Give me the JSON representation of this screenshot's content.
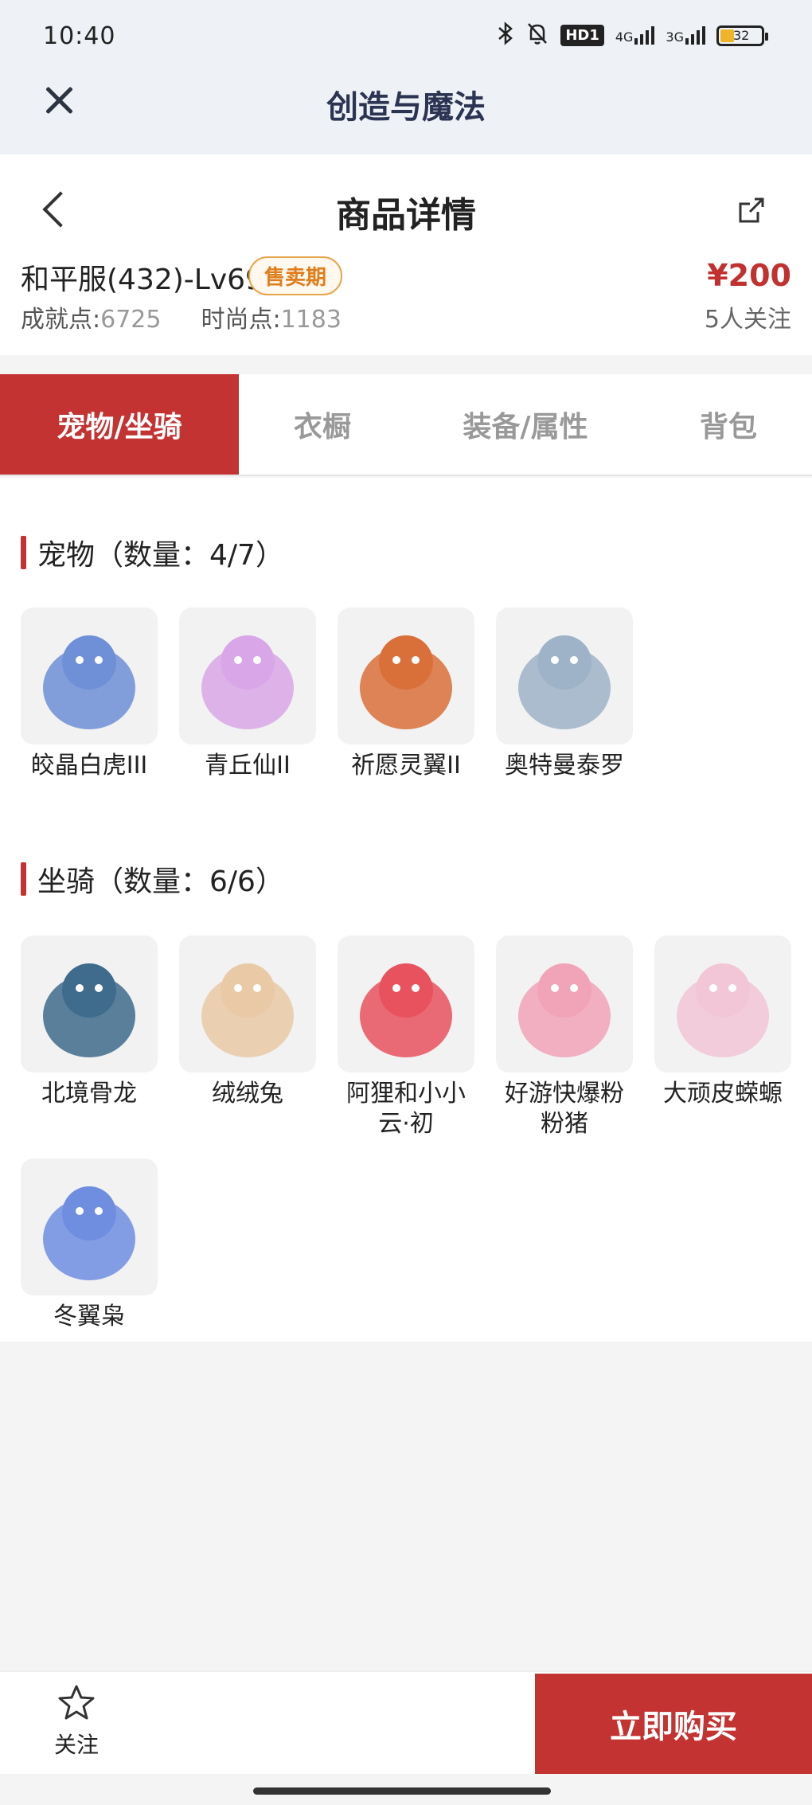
{
  "status_bar": {
    "time": "10:40",
    "hd_label": "HD1",
    "net1": "4G",
    "net2": "3G",
    "battery": "32",
    "battery_fraction": 0.32
  },
  "app": {
    "title": "创造与魔法"
  },
  "product": {
    "page_title": "商品详情",
    "name": "和平服(432)-Lv69",
    "badge": "售卖期",
    "price": "¥200",
    "achievement_label": "成就点:",
    "achievement_value": "6725",
    "fashion_label": "时尚点:",
    "fashion_value": "1183",
    "followers": "5人关注"
  },
  "tabs": [
    {
      "label": "宠物/坐骑",
      "active": true
    },
    {
      "label": "衣橱",
      "active": false
    },
    {
      "label": "装备/属性",
      "active": false
    },
    {
      "label": "背包",
      "active": false
    }
  ],
  "pets": {
    "title": "宠物（数量：4/7）",
    "items": [
      {
        "name": "皎晶白虎III",
        "color": "#6f8fd6",
        "icon": "tiger-icon"
      },
      {
        "name": "青丘仙II",
        "color": "#d9a7e8",
        "icon": "fox-spirit-icon"
      },
      {
        "name": "祈愿灵翼II",
        "color": "#d9703a",
        "icon": "eagle-icon"
      },
      {
        "name": "奥特曼泰罗",
        "color": "#9fb3c8",
        "icon": "ultraman-icon"
      }
    ]
  },
  "mounts": {
    "title": "坐骑（数量：6/6）",
    "items": [
      {
        "name": "北境骨龙",
        "color": "#3f6b8c",
        "icon": "bone-dragon-icon"
      },
      {
        "name": "绒绒兔",
        "color": "#e9c9a6",
        "icon": "rabbit-icon"
      },
      {
        "name": "阿狸和小小云·初",
        "color": "#e8525e",
        "icon": "fox-cloud-icon"
      },
      {
        "name": "好游快爆粉粉猪",
        "color": "#f1a3b8",
        "icon": "pig-icon"
      },
      {
        "name": "大顽皮蝾螈",
        "color": "#f2c6d6",
        "icon": "axolotl-icon"
      },
      {
        "name": "冬翼枭",
        "color": "#6f8ee0",
        "icon": "owl-icon"
      }
    ]
  },
  "bottom": {
    "follow_label": "关注",
    "buy_label": "立即购买"
  }
}
